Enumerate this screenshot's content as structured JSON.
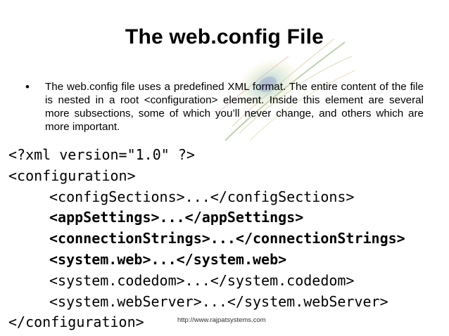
{
  "slide": {
    "title": "The web.config File",
    "bullet_symbol": "•",
    "bullet_text": "The web.config file uses a predefined XML format. The entire content of the file is nested in a root <configuration> element. Inside this element are several more subsections, some of which you’ll never change, and others which are more important.",
    "code_lines": [
      {
        "text": "<?xml version=\"1.0\" ?>",
        "bold": false,
        "indent": false
      },
      {
        "text": "<configuration>",
        "bold": false,
        "indent": false
      },
      {
        "text": "<configSections>...</configSections>",
        "bold": false,
        "indent": true
      },
      {
        "text": "<appSettings>...</appSettings>",
        "bold": true,
        "indent": true
      },
      {
        "text": "<connectionStrings>...</connectionStrings>",
        "bold": true,
        "indent": true
      },
      {
        "text": "<system.web>...</system.web>",
        "bold": true,
        "indent": true
      },
      {
        "text": "<system.codedom>...</system.codedom>",
        "bold": false,
        "indent": true
      },
      {
        "text": "<system.webServer>...</system.webServer>",
        "bold": false,
        "indent": true
      },
      {
        "text": "</configuration>",
        "bold": false,
        "indent": false
      }
    ],
    "footer_url": "http://www.rajpatsystems.com",
    "watermark_icon": "peacock-feather-icon"
  }
}
